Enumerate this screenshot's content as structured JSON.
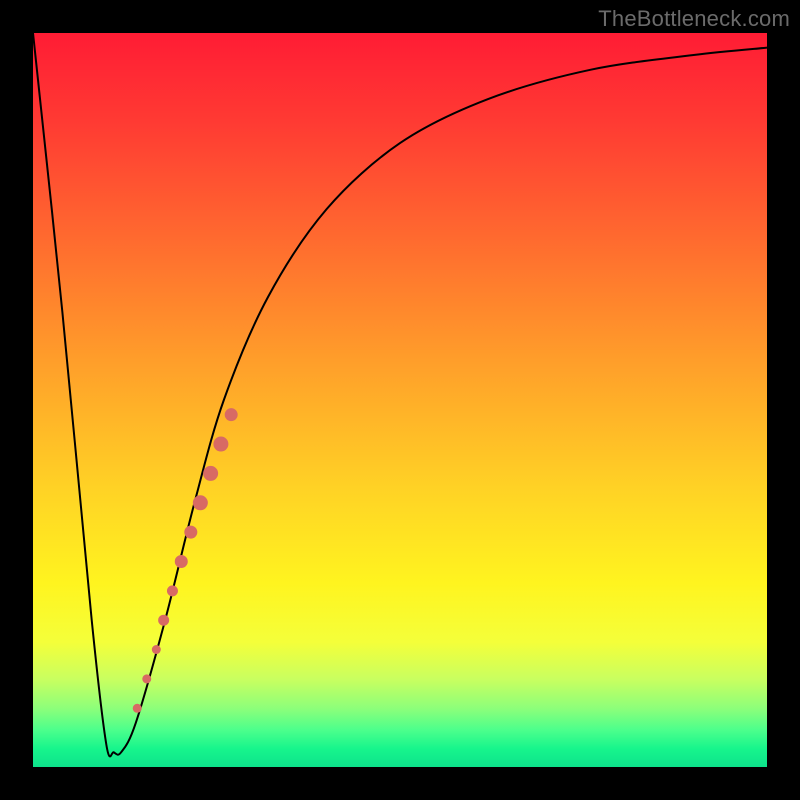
{
  "watermark": "TheBottleneck.com",
  "chart_data": {
    "type": "line",
    "title": "",
    "xlabel": "",
    "ylabel": "",
    "xlim": [
      0,
      100
    ],
    "ylim": [
      0,
      100
    ],
    "grid": false,
    "legend": false,
    "series": [
      {
        "name": "bottleneck-curve",
        "x": [
          0,
          4,
          8,
          10,
          11,
          12,
          14,
          18,
          22,
          26,
          32,
          40,
          50,
          62,
          76,
          90,
          100
        ],
        "y": [
          100,
          62,
          20,
          3,
          2,
          2,
          6,
          20,
          36,
          50,
          64,
          76,
          85,
          91,
          95,
          97,
          98
        ]
      }
    ],
    "markers": [
      {
        "x": 14.2,
        "y": 8,
        "r": 4
      },
      {
        "x": 15.5,
        "y": 12,
        "r": 4
      },
      {
        "x": 16.8,
        "y": 16,
        "r": 4
      },
      {
        "x": 17.8,
        "y": 20,
        "r": 5
      },
      {
        "x": 19.0,
        "y": 24,
        "r": 5
      },
      {
        "x": 20.2,
        "y": 28,
        "r": 6
      },
      {
        "x": 21.5,
        "y": 32,
        "r": 6
      },
      {
        "x": 22.8,
        "y": 36,
        "r": 7
      },
      {
        "x": 24.2,
        "y": 40,
        "r": 7
      },
      {
        "x": 25.6,
        "y": 44,
        "r": 7
      },
      {
        "x": 27.0,
        "y": 48,
        "r": 6
      }
    ],
    "gradient_stops": [
      {
        "pct": 0,
        "color": "#ff1c34"
      },
      {
        "pct": 12,
        "color": "#ff3a33"
      },
      {
        "pct": 28,
        "color": "#ff6a2f"
      },
      {
        "pct": 45,
        "color": "#ff9f2a"
      },
      {
        "pct": 62,
        "color": "#ffd225"
      },
      {
        "pct": 75,
        "color": "#fff41f"
      },
      {
        "pct": 83,
        "color": "#f4ff3a"
      },
      {
        "pct": 88,
        "color": "#c9ff5f"
      },
      {
        "pct": 92,
        "color": "#8dff7a"
      },
      {
        "pct": 95,
        "color": "#4bff8c"
      },
      {
        "pct": 97.5,
        "color": "#17f58c"
      },
      {
        "pct": 100,
        "color": "#0de28b"
      }
    ]
  }
}
